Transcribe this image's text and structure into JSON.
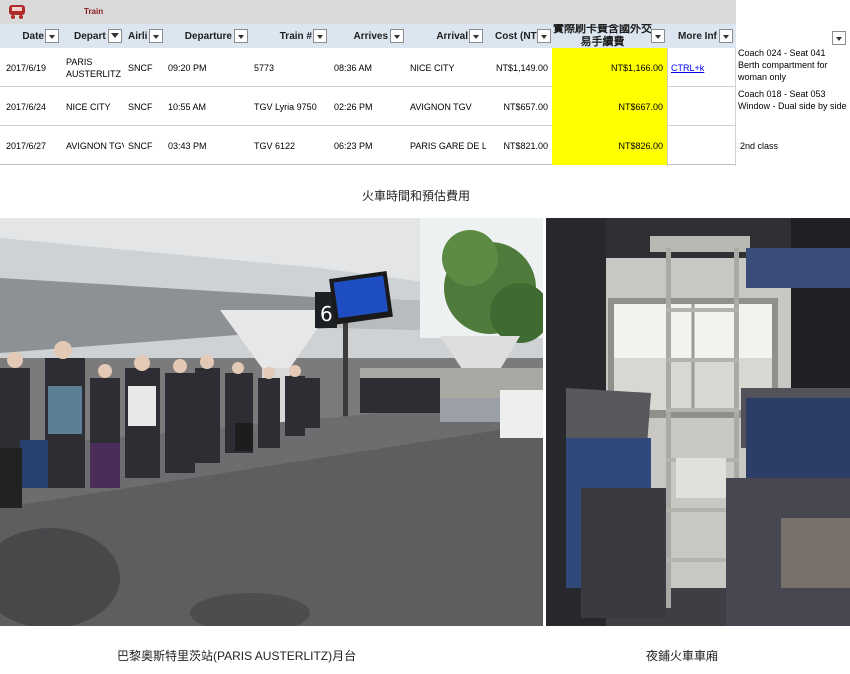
{
  "app": {
    "title": "Train",
    "icon": "train-icon"
  },
  "table": {
    "headers": [
      "Date",
      "Depart",
      "Airli",
      "Departure",
      "Train #",
      "Arrives",
      "Arrival",
      "Cost (NTD",
      "實際刷卡費含國外交易手續費",
      "More Inf"
    ],
    "rows": [
      {
        "date": "2017/6/19",
        "depart": "PARIS AUSTERLITZ",
        "airline": "SNCF",
        "departure": "09:20 PM",
        "train": "5773",
        "arrives": "08:36 AM",
        "arrival": "NICE CITY",
        "cost": "NT$1,149.00",
        "actual": "NT$1,166.00",
        "more": "CTRL+k",
        "note": "Coach 024 - Seat 041 Berth compartment for woman only"
      },
      {
        "date": "2017/6/24",
        "depart": "NICE CITY",
        "airline": "SNCF",
        "departure": "10:55 AM",
        "train": "TGV Lyria 9750",
        "arrives": "02:26 PM",
        "arrival": "AVIGNON TGV",
        "cost": "NT$657.00",
        "actual": "NT$667.00",
        "more": "",
        "note": "Coach 018 - Seat 053 Window - Dual side by side"
      },
      {
        "date": "2017/6/27",
        "depart": "AVIGNON TGV",
        "airline": "SNCF",
        "departure": "03:43 PM",
        "train": "TGV 6122",
        "arrives": "06:23 PM",
        "arrival": "PARIS GARE DE LY",
        "cost": "NT$821.00",
        "actual": "NT$826.00",
        "more": "",
        "note": "2nd class"
      }
    ],
    "highlight_color": "#ffff00",
    "header_color": "#dce6f1"
  },
  "captions": {
    "table": "火車時間和預估費用",
    "station": "巴黎奧斯特里茨站(PARIS AUSTERLITZ)月台",
    "sleeper": "夜鋪火車車廂"
  },
  "station_sign": {
    "platform": "6"
  }
}
